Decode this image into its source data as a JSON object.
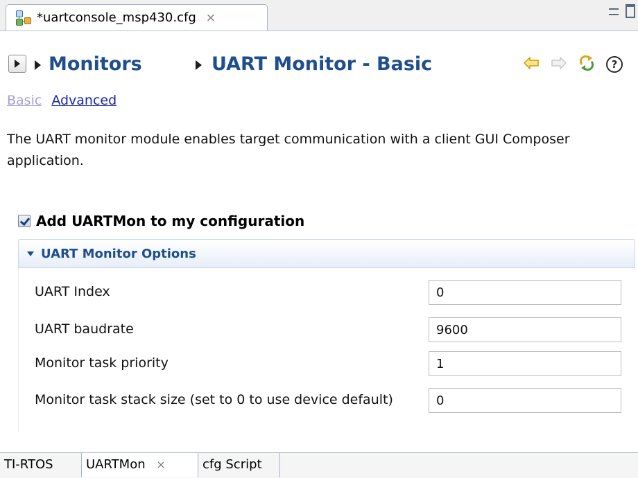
{
  "editor_tab": {
    "title": "*uartconsole_msp430.cfg",
    "close": "⨯"
  },
  "window_controls": [
    "minimize-icon",
    "maximize-icon"
  ],
  "breadcrumb": {
    "parent": "Monitors",
    "current": "UART Monitor - Basic"
  },
  "header_icons": [
    "back-arrow-icon",
    "forward-arrow-icon",
    "refresh-icon",
    "help-icon"
  ],
  "help_glyph": "?",
  "links": {
    "basic": "Basic",
    "advanced": "Advanced"
  },
  "description": "The UART monitor module enables target communication with a client GUI Composer application.",
  "add_module": {
    "label": "Add UARTMon to my configuration",
    "checked": true
  },
  "section": {
    "title": "UART Monitor Options",
    "expanded": true,
    "options": [
      {
        "label": "UART Index",
        "value": "0"
      },
      {
        "label": "UART baudrate",
        "value": "9600"
      },
      {
        "label": "Monitor task priority",
        "value": "1"
      },
      {
        "label": "Monitor task stack size (set to 0 to use device default)",
        "value": "0"
      }
    ]
  },
  "bottom_tabs": [
    {
      "label": "TI-RTOS",
      "active": false
    },
    {
      "label": "UARTMon",
      "active": true,
      "close": "⨯"
    },
    {
      "label": "cfg Script",
      "active": false
    }
  ],
  "colors": {
    "heading": "#1f4e8c",
    "link_visited": "#a79ed8",
    "link": "#1a25a6",
    "arrow_enabled": "#e0b020",
    "arrow_disabled": "#c8c8c8"
  }
}
